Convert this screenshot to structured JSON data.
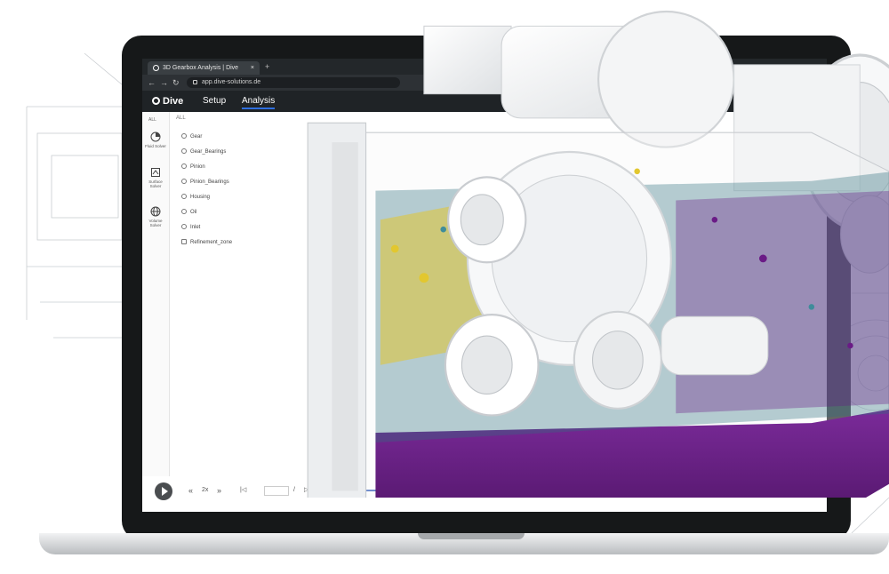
{
  "browser": {
    "tab_title": "3D Gearbox Analysis | Dive",
    "tab_close": "×",
    "new_tab": "+",
    "back": "←",
    "forward": "→",
    "reload": "↻",
    "url": "app.dive-solutions.de"
  },
  "app": {
    "logo_text": "Dive",
    "menu": [
      {
        "label": "Setup",
        "active": false
      },
      {
        "label": "Analysis",
        "active": true
      }
    ]
  },
  "toolstrip": {
    "all_label": "ALL",
    "tools": [
      {
        "label": "Fluid Solver",
        "icon": "pie-chart-icon"
      },
      {
        "label": "Surface Solver",
        "icon": "surface-icon"
      },
      {
        "label": "Volume Solver",
        "icon": "globe-icon"
      }
    ]
  },
  "tree": {
    "header": "ALL",
    "items": [
      "Gear",
      "Gear_Bearings",
      "Pinion",
      "Pinion_Bearings",
      "Housing",
      "Oil",
      "Inlet",
      "Refinement_zone"
    ]
  },
  "playback": {
    "speed": "2x",
    "prev_frame": "|◁",
    "next_frame": "▷|",
    "rewind": "«",
    "fast_forward": "»",
    "frame_sep": "/",
    "progress": 0.64,
    "markers": [
      0.37,
      0.43
    ]
  },
  "colors": {
    "oil": "#6a1b86",
    "oil_light": "#7b2b9a",
    "particles_yellow": "#e2c72f",
    "particles_teal": "#3f8c9a",
    "accent": "#2a57b8",
    "app_bar": "#1f2326"
  }
}
